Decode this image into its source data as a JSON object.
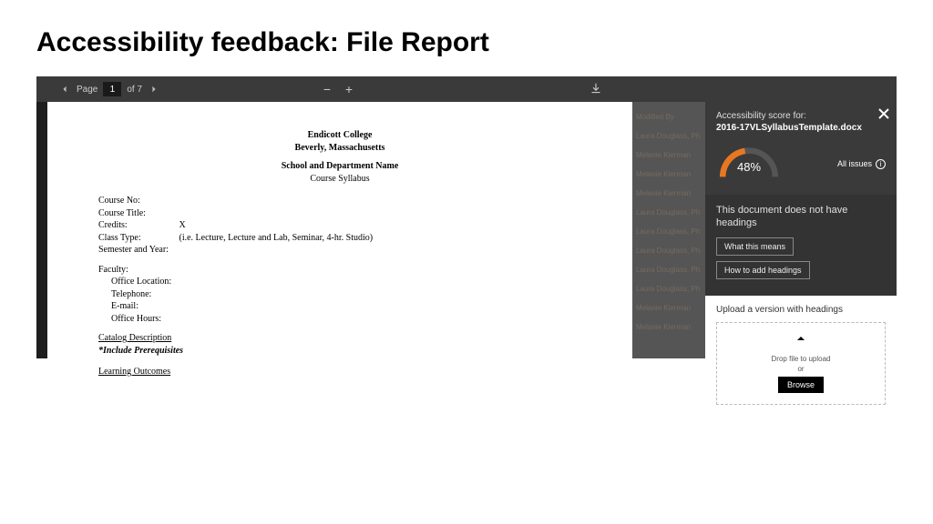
{
  "slide": {
    "title": "Accessibility feedback: File Report"
  },
  "toolbar": {
    "page_label": "Page",
    "page_current": "1",
    "page_of": "of 7"
  },
  "document": {
    "header1": "Endicott College",
    "header2": "Beverly, Massachusetts",
    "header3": "School and Department Name",
    "header4": "Course Syllabus",
    "fields": {
      "course_no": "Course No:",
      "course_title": "Course Title:",
      "credits_label": "Credits:",
      "credits_val": "X",
      "class_type_label": "Class Type:",
      "class_type_val": "(i.e. Lecture, Lecture and Lab, Seminar, 4-hr. Studio)",
      "semester": "Semester and Year:",
      "faculty": "Faculty:",
      "office_location": "Office Location:",
      "telephone": "Telephone:",
      "email": "E-mail:",
      "office_hours": "Office Hours:",
      "catalog": "Catalog Description",
      "prereq": "*Include Prerequisites",
      "outcomes": "Learning Outcomes"
    }
  },
  "dim": {
    "r0": "Modified By",
    "r1": "Laura Douglass, Ph",
    "r2": "Melanie Kierman",
    "r3": "Melanie Kierman",
    "r4": "Melanie Kierman",
    "r5": "Laura Douglass, Ph",
    "r6": "Laura Douglass, Ph",
    "r7": "Laura Douglass, Ph",
    "r8": "Laura Douglass, Ph",
    "r9": "Laura Douglass, Ph",
    "r10": "Melanie Kierman",
    "r11": "Melanie Kierman"
  },
  "panel": {
    "score_for": "Accessibility score for:",
    "file_name": "2016-17VLSyllabusTemplate.docx",
    "percent": "48%",
    "all_issues": "All issues",
    "issue_title": "This document does not have headings",
    "btn_what": "What this means",
    "btn_how": "How to add headings",
    "upload_label": "Upload a version with headings",
    "drop_text": "Drop file to upload",
    "or": "or",
    "browse": "Browse"
  },
  "chart_data": {
    "type": "pie",
    "title": "Accessibility score",
    "categories": [
      "Score",
      "Remaining"
    ],
    "values": [
      48,
      52
    ],
    "ylim": [
      0,
      100
    ]
  }
}
